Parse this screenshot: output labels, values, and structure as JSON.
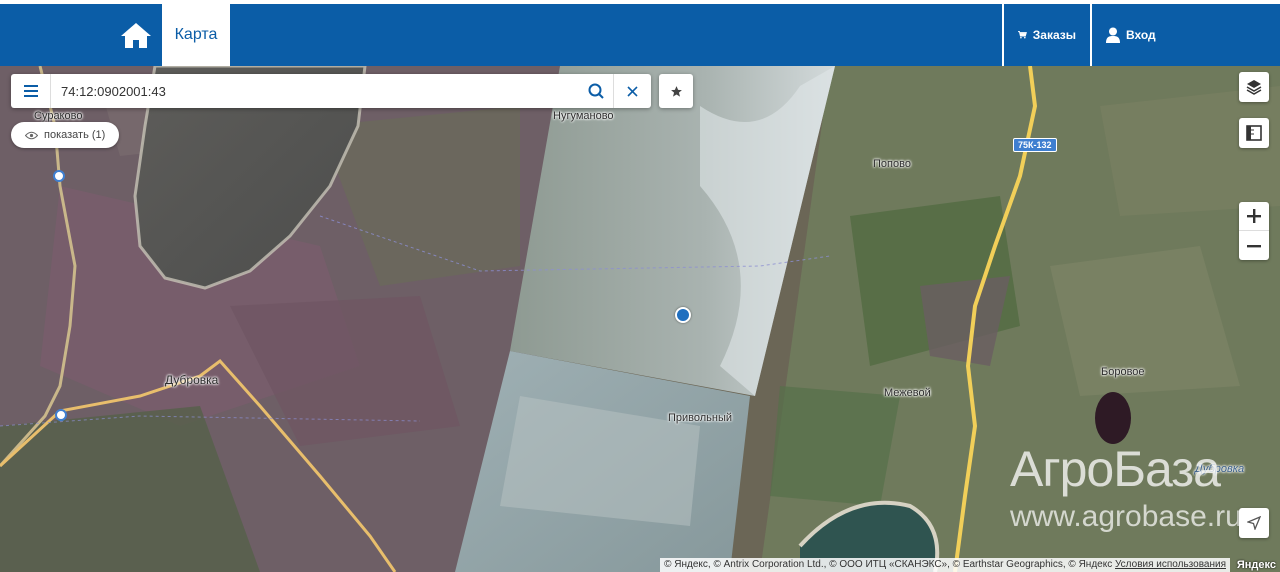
{
  "nav": {
    "home_icon": "home-icon",
    "map_tab": "Карта",
    "orders": "Заказы",
    "orders_icon": "cart-icon",
    "login": "Вход",
    "login_icon": "user-icon"
  },
  "search": {
    "value": "74:12:0902001:43",
    "menu_icon": "menu-icon",
    "search_icon": "search-icon",
    "clear_icon": "close-icon",
    "favorite_icon": "star-icon"
  },
  "show_button": "показать (1)",
  "map_labels": {
    "surakovo": "Сураково",
    "nugumanovo": "Нугуманово",
    "popovo": "Попово",
    "dubrovka": "Дубровка",
    "privolny": "Привольный",
    "mezhevoy": "Межевой",
    "borovoe": "Боровое",
    "dubrovka_river": "Дубровка",
    "road_sign": "75К-132"
  },
  "watermark": {
    "title": "АгроБаза",
    "url": "www.agrobase.ru"
  },
  "copyright": {
    "text": "© Яндекс, © Antrix Corporation Ltd., © ООО ИТЦ «СКАНЭКС», © Earthstar Geographics, © Яндекс",
    "terms": "Условия использования",
    "logo": "Яндекс"
  },
  "colors": {
    "nav_background": "#0b5da7",
    "marker": "#1f6fbf"
  }
}
